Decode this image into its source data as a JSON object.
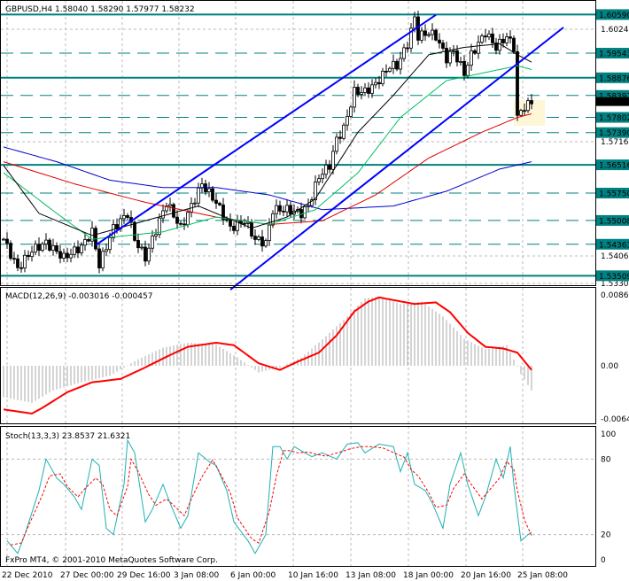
{
  "header": {
    "symbol": "GBPUSD,H4",
    "open": "1.58040",
    "high": "1.58290",
    "low": "1.57977",
    "close": "1.58232"
  },
  "macd_header": "MACD(12,26,9) -0.003016 -0.000457",
  "stoch_header": "Stoch(13,3,3) 23.8537 21.6321",
  "copyright": "FxPro MT4, © 2001-2010 MetaQuotes Software Corp.",
  "colors": {
    "level": "#008080",
    "channel": "#0000ff",
    "ma_fast": "#000000",
    "ma_mid": "#00c060",
    "ma_slow": "#e00000",
    "ma_long": "#0000cc",
    "signal": "#ff0000",
    "stoch_main": "#20b0b0"
  },
  "chart_data": {
    "type": "candlestick",
    "title": "GBPUSD,H4",
    "x_ticks": [
      "22 Dec 2010",
      "27 Dec 00:00",
      "29 Dec 16:00",
      "3 Jan 08:00",
      "6 Jan 00:00",
      "10 Jan 16:00",
      "13 Jan 08:00",
      "18 Jan 00:00",
      "20 Jan 16:00",
      "25 Jan 08:00"
    ],
    "price_ticks": [
      "1.60240",
      "1.57160",
      "1.54060",
      "1.53300"
    ],
    "current_price": "1.58232",
    "ylim": [
      1.5326,
      1.6075
    ],
    "solid_levels": [
      "1.60590",
      "1.58876",
      "1.56516",
      "1.53509"
    ],
    "dashed_levels": [
      "1.59543",
      "1.58397",
      "1.57802",
      "1.57390",
      "1.55750",
      "1.55008",
      "1.54363"
    ],
    "bar_count": 150,
    "close_path": [
      [
        0,
        1.545
      ],
      [
        4,
        1.537
      ],
      [
        8,
        1.542
      ],
      [
        12,
        1.544
      ],
      [
        17,
        1.54
      ],
      [
        22,
        1.543
      ],
      [
        25,
        1.547
      ],
      [
        27,
        1.538
      ],
      [
        31,
        1.548
      ],
      [
        35,
        1.552
      ],
      [
        37,
        1.545
      ],
      [
        40,
        1.54
      ],
      [
        44,
        1.55
      ],
      [
        46,
        1.555
      ],
      [
        50,
        1.548
      ],
      [
        54,
        1.556
      ],
      [
        56,
        1.56
      ],
      [
        60,
        1.555
      ],
      [
        64,
        1.548
      ],
      [
        68,
        1.55
      ],
      [
        71,
        1.545
      ],
      [
        74,
        1.544
      ],
      [
        76,
        1.553
      ],
      [
        80,
        1.553
      ],
      [
        84,
        1.552
      ],
      [
        86,
        1.554
      ],
      [
        89,
        1.562
      ],
      [
        92,
        1.565
      ],
      [
        94,
        1.572
      ],
      [
        96,
        1.575
      ],
      [
        99,
        1.585
      ],
      [
        102,
        1.585
      ],
      [
        105,
        1.587
      ],
      [
        109,
        1.592
      ],
      [
        111,
        1.592
      ],
      [
        114,
        1.598
      ],
      [
        116,
        1.605
      ],
      [
        117,
        1.6
      ],
      [
        120,
        1.601
      ],
      [
        122,
        1.6
      ],
      [
        125,
        1.594
      ],
      [
        127,
        1.596
      ],
      [
        130,
        1.59
      ],
      [
        132,
        1.595
      ],
      [
        136,
        1.601
      ],
      [
        139,
        1.597
      ],
      [
        142,
        1.6
      ],
      [
        144,
        1.597
      ],
      [
        145,
        1.578
      ],
      [
        147,
        1.581
      ],
      [
        149,
        1.582
      ]
    ],
    "ma_fast": [
      [
        0,
        1.565
      ],
      [
        10,
        1.552
      ],
      [
        25,
        1.546
      ],
      [
        40,
        1.55
      ],
      [
        55,
        1.554
      ],
      [
        70,
        1.548
      ],
      [
        80,
        1.551
      ],
      [
        88,
        1.556
      ],
      [
        100,
        1.574
      ],
      [
        110,
        1.584
      ],
      [
        120,
        1.595
      ],
      [
        130,
        1.597
      ],
      [
        140,
        1.598
      ],
      [
        145,
        1.595
      ],
      [
        149,
        1.593
      ]
    ],
    "ma_mid": [
      [
        0,
        1.563
      ],
      [
        15,
        1.552
      ],
      [
        25,
        1.545
      ],
      [
        45,
        1.547
      ],
      [
        60,
        1.551
      ],
      [
        75,
        1.549
      ],
      [
        88,
        1.553
      ],
      [
        100,
        1.563
      ],
      [
        112,
        1.578
      ],
      [
        125,
        1.588
      ],
      [
        135,
        1.59
      ],
      [
        145,
        1.592
      ],
      [
        149,
        1.591
      ]
    ],
    "ma_slow": [
      [
        0,
        1.566
      ],
      [
        20,
        1.56
      ],
      [
        40,
        1.555
      ],
      [
        60,
        1.551
      ],
      [
        75,
        1.549
      ],
      [
        90,
        1.55
      ],
      [
        105,
        1.557
      ],
      [
        120,
        1.567
      ],
      [
        135,
        1.574
      ],
      [
        145,
        1.578
      ],
      [
        149,
        1.579
      ]
    ],
    "ma_long": [
      [
        0,
        1.57
      ],
      [
        15,
        1.566
      ],
      [
        30,
        1.561
      ],
      [
        45,
        1.559
      ],
      [
        60,
        1.559
      ],
      [
        75,
        1.557
      ],
      [
        90,
        1.553
      ],
      [
        110,
        1.554
      ],
      [
        125,
        1.558
      ],
      [
        140,
        1.564
      ],
      [
        149,
        1.566
      ]
    ],
    "channel_upper": [
      [
        26,
        1.5434
      ],
      [
        122,
        1.6058
      ]
    ],
    "channel_lower": [
      [
        64,
        1.5313
      ],
      [
        158,
        1.6024
      ]
    ],
    "macd": {
      "ylim": [
        -0.00646,
        0.0086
      ],
      "ticks": [
        "0.008600",
        "0.00",
        "-0.006460"
      ],
      "signal": [
        [
          0,
          -0.0053
        ],
        [
          8,
          -0.0058
        ],
        [
          11,
          -0.0051
        ],
        [
          18,
          -0.0032
        ],
        [
          25,
          -0.002
        ],
        [
          33,
          -0.0016
        ],
        [
          40,
          -0.0002
        ],
        [
          46,
          0.0011
        ],
        [
          52,
          0.0023
        ],
        [
          60,
          0.0028
        ],
        [
          65,
          0.0025
        ],
        [
          72,
          0.0003
        ],
        [
          78,
          -0.0005
        ],
        [
          83,
          0.0005
        ],
        [
          89,
          0.0016
        ],
        [
          94,
          0.0037
        ],
        [
          99,
          0.0066
        ],
        [
          103,
          0.0078
        ],
        [
          106,
          0.0083
        ],
        [
          111,
          0.0079
        ],
        [
          116,
          0.0075
        ],
        [
          122,
          0.0077
        ],
        [
          126,
          0.0065
        ],
        [
          131,
          0.004
        ],
        [
          136,
          0.0023
        ],
        [
          141,
          0.0021
        ],
        [
          145,
          0.0016
        ],
        [
          149,
          -0.0005
        ]
      ],
      "histogram": [
        [
          0,
          -0.0038
        ],
        [
          8,
          -0.0045
        ],
        [
          14,
          -0.003
        ],
        [
          22,
          -0.002
        ],
        [
          30,
          -0.0012
        ],
        [
          38,
          0.0008
        ],
        [
          45,
          0.0022
        ],
        [
          52,
          0.0028
        ],
        [
          60,
          0.0026
        ],
        [
          66,
          0.001
        ],
        [
          72,
          -0.0008
        ],
        [
          78,
          -0.0002
        ],
        [
          84,
          0.001
        ],
        [
          90,
          0.0032
        ],
        [
          97,
          0.006
        ],
        [
          102,
          0.0082
        ],
        [
          106,
          0.0084
        ],
        [
          112,
          0.0075
        ],
        [
          118,
          0.0078
        ],
        [
          124,
          0.006
        ],
        [
          130,
          0.0033
        ],
        [
          136,
          0.002
        ],
        [
          142,
          0.0025
        ],
        [
          146,
          -0.001
        ],
        [
          149,
          -0.003
        ]
      ]
    },
    "stoch": {
      "ylim": [
        0,
        100
      ],
      "ticks": [
        "100",
        "80",
        "20",
        "0"
      ],
      "main": [
        [
          1,
          15
        ],
        [
          4,
          5
        ],
        [
          6,
          20
        ],
        [
          10,
          55
        ],
        [
          12,
          80
        ],
        [
          15,
          65
        ],
        [
          17,
          60
        ],
        [
          20,
          50
        ],
        [
          22,
          40
        ],
        [
          25,
          80
        ],
        [
          27,
          75
        ],
        [
          29,
          25
        ],
        [
          31,
          20
        ],
        [
          34,
          60
        ],
        [
          35,
          95
        ],
        [
          37,
          85
        ],
        [
          40,
          30
        ],
        [
          42,
          40
        ],
        [
          45,
          60
        ],
        [
          47,
          45
        ],
        [
          50,
          25
        ],
        [
          52,
          35
        ],
        [
          55,
          85
        ],
        [
          58,
          78
        ],
        [
          60,
          75
        ],
        [
          63,
          55
        ],
        [
          65,
          30
        ],
        [
          69,
          15
        ],
        [
          71,
          5
        ],
        [
          74,
          20
        ],
        [
          76,
          90
        ],
        [
          78,
          90
        ],
        [
          80,
          80
        ],
        [
          82,
          90
        ],
        [
          85,
          85
        ],
        [
          87,
          82
        ],
        [
          90,
          85
        ],
        [
          94,
          80
        ],
        [
          97,
          92
        ],
        [
          100,
          93
        ],
        [
          102,
          85
        ],
        [
          106,
          92
        ],
        [
          110,
          90
        ],
        [
          112,
          70
        ],
        [
          114,
          85
        ],
        [
          116,
          60
        ],
        [
          119,
          55
        ],
        [
          121,
          45
        ],
        [
          124,
          25
        ],
        [
          126,
          60
        ],
        [
          129,
          85
        ],
        [
          131,
          60
        ],
        [
          134,
          35
        ],
        [
          136,
          50
        ],
        [
          139,
          80
        ],
        [
          141,
          65
        ],
        [
          143,
          90
        ],
        [
          144,
          60
        ],
        [
          146,
          15
        ],
        [
          148,
          20
        ],
        [
          149,
          22
        ]
      ]
    }
  }
}
